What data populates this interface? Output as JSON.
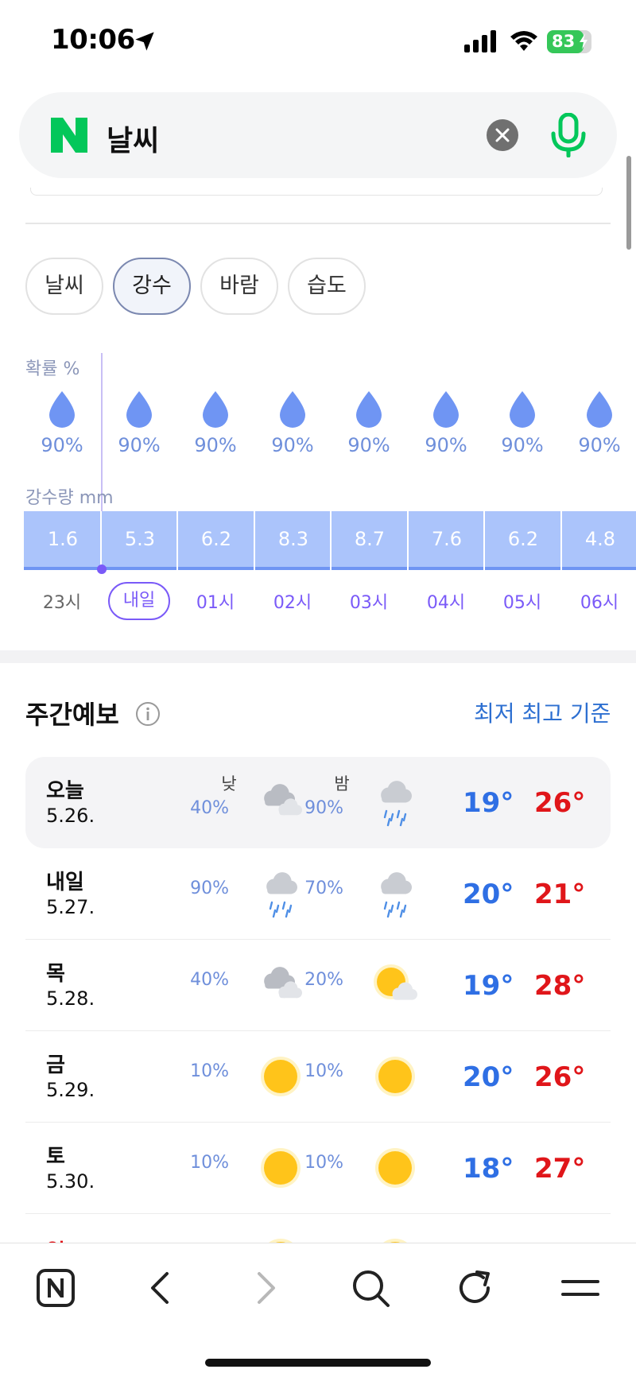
{
  "status_bar": {
    "time": "10:06",
    "battery": "83",
    "battery_level": 0.83
  },
  "search": {
    "logo": "N",
    "query": "날씨"
  },
  "tabs": [
    {
      "label": "날씨",
      "active": false
    },
    {
      "label": "강수",
      "active": true
    },
    {
      "label": "바람",
      "active": false
    },
    {
      "label": "습도",
      "active": false
    }
  ],
  "precip": {
    "probability_label": "확률 %",
    "amount_label": "강수량 mm",
    "probabilities": [
      "90%",
      "90%",
      "90%",
      "90%",
      "90%",
      "90%",
      "90%",
      "90%"
    ],
    "amounts": [
      "1.6",
      "5.3",
      "6.2",
      "8.3",
      "8.7",
      "7.6",
      "6.2",
      "4.8"
    ],
    "hours": [
      "23시",
      "내일",
      "01시",
      "02시",
      "03시",
      "04시",
      "05시",
      "06시"
    ]
  },
  "weekly": {
    "title": "주간예보",
    "basis": "최저 최고 기준",
    "days": [
      {
        "name": "오늘",
        "date": "5.26.",
        "am_label": "낮",
        "pm_label": "밤",
        "am_pct": "40%",
        "pm_pct": "90%",
        "am_icon": "cloudy-icon",
        "pm_icon": "rain-icon",
        "low": "19°",
        "high": "26°"
      },
      {
        "name": "내일",
        "date": "5.27.",
        "am_label": "",
        "pm_label": "",
        "am_pct": "90%",
        "pm_pct": "70%",
        "am_icon": "rain-icon",
        "pm_icon": "rain-icon",
        "low": "20°",
        "high": "21°"
      },
      {
        "name": "목",
        "date": "5.28.",
        "am_label": "",
        "pm_label": "",
        "am_pct": "40%",
        "pm_pct": "20%",
        "am_icon": "cloudy-icon",
        "pm_icon": "partly-cloudy-icon",
        "low": "19°",
        "high": "28°"
      },
      {
        "name": "금",
        "date": "5.29.",
        "am_label": "",
        "pm_label": "",
        "am_pct": "10%",
        "pm_pct": "10%",
        "am_icon": "sun-icon",
        "pm_icon": "sun-icon",
        "low": "20°",
        "high": "26°"
      },
      {
        "name": "토",
        "date": "5.30.",
        "am_label": "",
        "pm_label": "",
        "am_pct": "10%",
        "pm_pct": "10%",
        "am_icon": "sun-icon",
        "pm_icon": "sun-icon",
        "low": "18°",
        "high": "27°"
      }
    ],
    "partial_day": "일"
  },
  "colors": {
    "accent": "#7a5af8",
    "low_temp": "#2f6fe4",
    "high_temp": "#e0161a",
    "naver_green": "#03c75a",
    "bar": "#abc4fb"
  },
  "toolbar": {
    "icons": [
      "naver-home-icon",
      "back-icon",
      "forward-icon",
      "search-icon",
      "reload-icon",
      "menu-icon"
    ]
  }
}
